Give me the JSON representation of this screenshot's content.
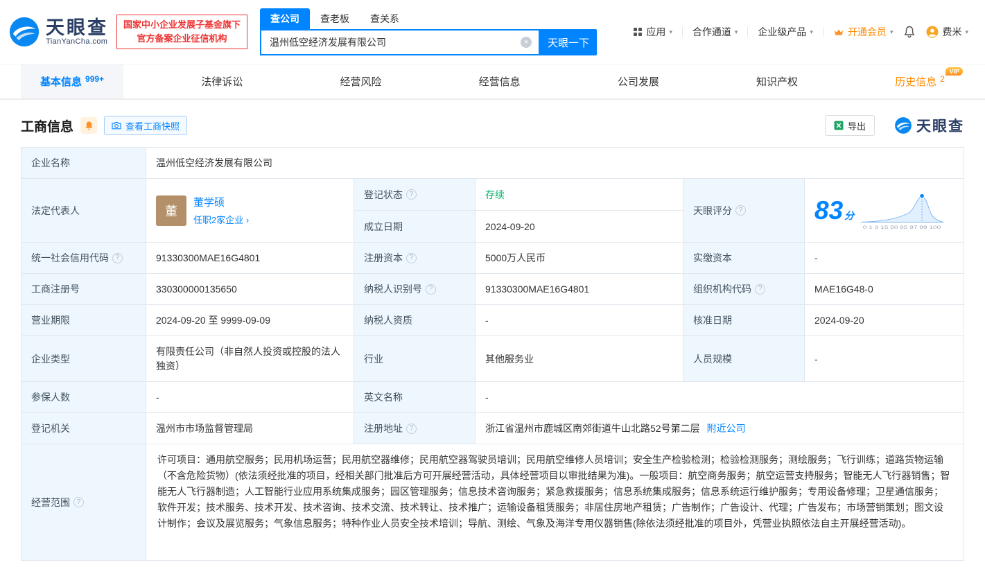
{
  "icons": {
    "help": "?",
    "clear": "×",
    "caret": "▾"
  },
  "header": {
    "logo_brand": "天眼查",
    "logo_domain": "TianYanCha.com",
    "badge_line1": "国家中小企业发展子基金旗下",
    "badge_line2": "官方备案企业征信机构",
    "search_tabs": [
      {
        "label": "查公司"
      },
      {
        "label": "查老板"
      },
      {
        "label": "查关系"
      }
    ],
    "search_value": "温州低空经济发展有限公司",
    "search_button": "天眼一下",
    "nav_app": "应用",
    "nav_coop": "合作通道",
    "nav_enterprise": "企业级产品",
    "nav_vip": "开通会员",
    "nav_user": "费米"
  },
  "tabs": [
    {
      "label": "基本信息",
      "badge": "999+"
    },
    {
      "label": "法律诉讼",
      "badge": ""
    },
    {
      "label": "经营风险",
      "badge": ""
    },
    {
      "label": "经营信息",
      "badge": ""
    },
    {
      "label": "公司发展",
      "badge": ""
    },
    {
      "label": "知识产权",
      "badge": ""
    },
    {
      "label": "历史信息",
      "badge": "2",
      "vip": "VIP"
    }
  ],
  "section": {
    "title": "工商信息",
    "snapshot_button": "查看工商快照",
    "export_button": "导出",
    "brand_text": "天眼查"
  },
  "table": {
    "company_name_label": "企业名称",
    "company_name": "温州低空经济发展有限公司",
    "legal_rep_label": "法定代表人",
    "legal_rep_avatar": "董",
    "legal_rep_name": "董学硕",
    "legal_rep_link": "任职2家企业 ›",
    "reg_status_label": "登记状态",
    "reg_status": "存续",
    "establish_date_label": "成立日期",
    "establish_date": "2024-09-20",
    "score_label": "天眼评分",
    "score_value": "83",
    "score_unit": "分",
    "score_axis": "0 1 3 15 50 85 97 99 100",
    "credit_code_label": "统一社会信用代码",
    "credit_code": "91330300MAE16G4801",
    "reg_capital_label": "注册资本",
    "reg_capital": "5000万人民币",
    "paid_capital_label": "实缴资本",
    "paid_capital": "-",
    "reg_number_label": "工商注册号",
    "reg_number": "330300000135650",
    "taxpayer_id_label": "纳税人识别号",
    "taxpayer_id": "91330300MAE16G4801",
    "org_code_label": "组织机构代码",
    "org_code": "MAE16G48-0",
    "business_term_label": "营业期限",
    "business_term": "2024-09-20 至 9999-09-09",
    "taxpayer_quality_label": "纳税人资质",
    "taxpayer_quality": "-",
    "approval_date_label": "核准日期",
    "approval_date": "2024-09-20",
    "company_type_label": "企业类型",
    "company_type": "有限责任公司（非自然人投资或控股的法人独资）",
    "industry_label": "行业",
    "industry": "其他服务业",
    "staff_size_label": "人员规模",
    "staff_size": "-",
    "insured_label": "参保人数",
    "insured": "-",
    "english_name_label": "英文名称",
    "english_name": "-",
    "reg_authority_label": "登记机关",
    "reg_authority": "温州市市场监督管理局",
    "reg_address_label": "注册地址",
    "reg_address": "浙江省温州市鹿城区南郊街道牛山北路52号第二层",
    "nearby_link": "附近公司",
    "business_scope_label": "经营范围",
    "business_scope": "许可项目：通用航空服务；民用机场运营；民用航空器维修；民用航空器驾驶员培训；民用航空维修人员培训；安全生产检验检测；检验检测服务；测绘服务；飞行训练；道路货物运输（不含危险货物）(依法须经批准的项目，经相关部门批准后方可开展经营活动，具体经营项目以审批结果为准)。一般项目：航空商务服务；航空运营支持服务；智能无人飞行器销售；智能无人飞行器制造；人工智能行业应用系统集成服务；园区管理服务；信息技术咨询服务；紧急救援服务；信息系统集成服务；信息系统运行维护服务；专用设备修理；卫星通信服务；软件开发；技术服务、技术开发、技术咨询、技术交流、技术转让、技术推广；运输设备租赁服务；非居住房地产租赁；广告制作；广告设计、代理；广告发布；市场营销策划；图文设计制作；会议及展览服务；气象信息服务；特种作业人员安全技术培训；导航、测绘、气象及海洋专用仪器销售(除依法须经批准的项目外，凭营业执照依法自主开展经营活动)。"
  }
}
